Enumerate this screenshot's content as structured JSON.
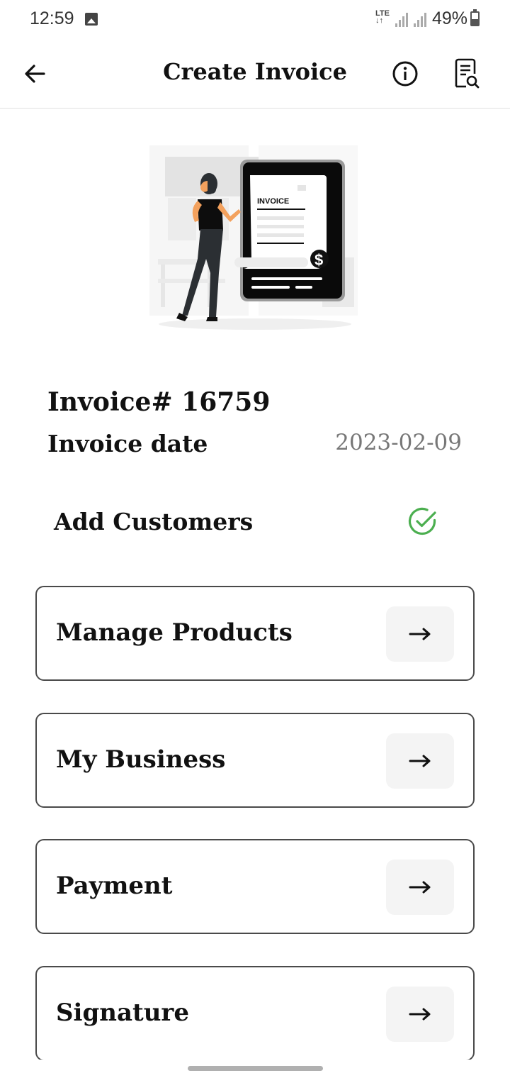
{
  "status_bar": {
    "time": "12:59",
    "network": "LTE",
    "battery": "49%"
  },
  "app_bar": {
    "title": "Create Invoice"
  },
  "illustration": {
    "invoice_word": "INVOICE",
    "currency_symbol": "$"
  },
  "invoice": {
    "number_label": "Invoice# 16759",
    "date_label": "Invoice date",
    "date_value": "2023-02-09"
  },
  "customers": {
    "label": "Add Customers",
    "status_icon": "check-circle-icon",
    "status_color": "#4caf50"
  },
  "menu": [
    {
      "label": "Manage Products",
      "icon": "arrow-right-icon"
    },
    {
      "label": "My Business",
      "icon": "arrow-right-icon"
    },
    {
      "label": "Payment",
      "icon": "arrow-right-icon"
    },
    {
      "label": "Signature",
      "icon": "arrow-right-icon"
    }
  ]
}
